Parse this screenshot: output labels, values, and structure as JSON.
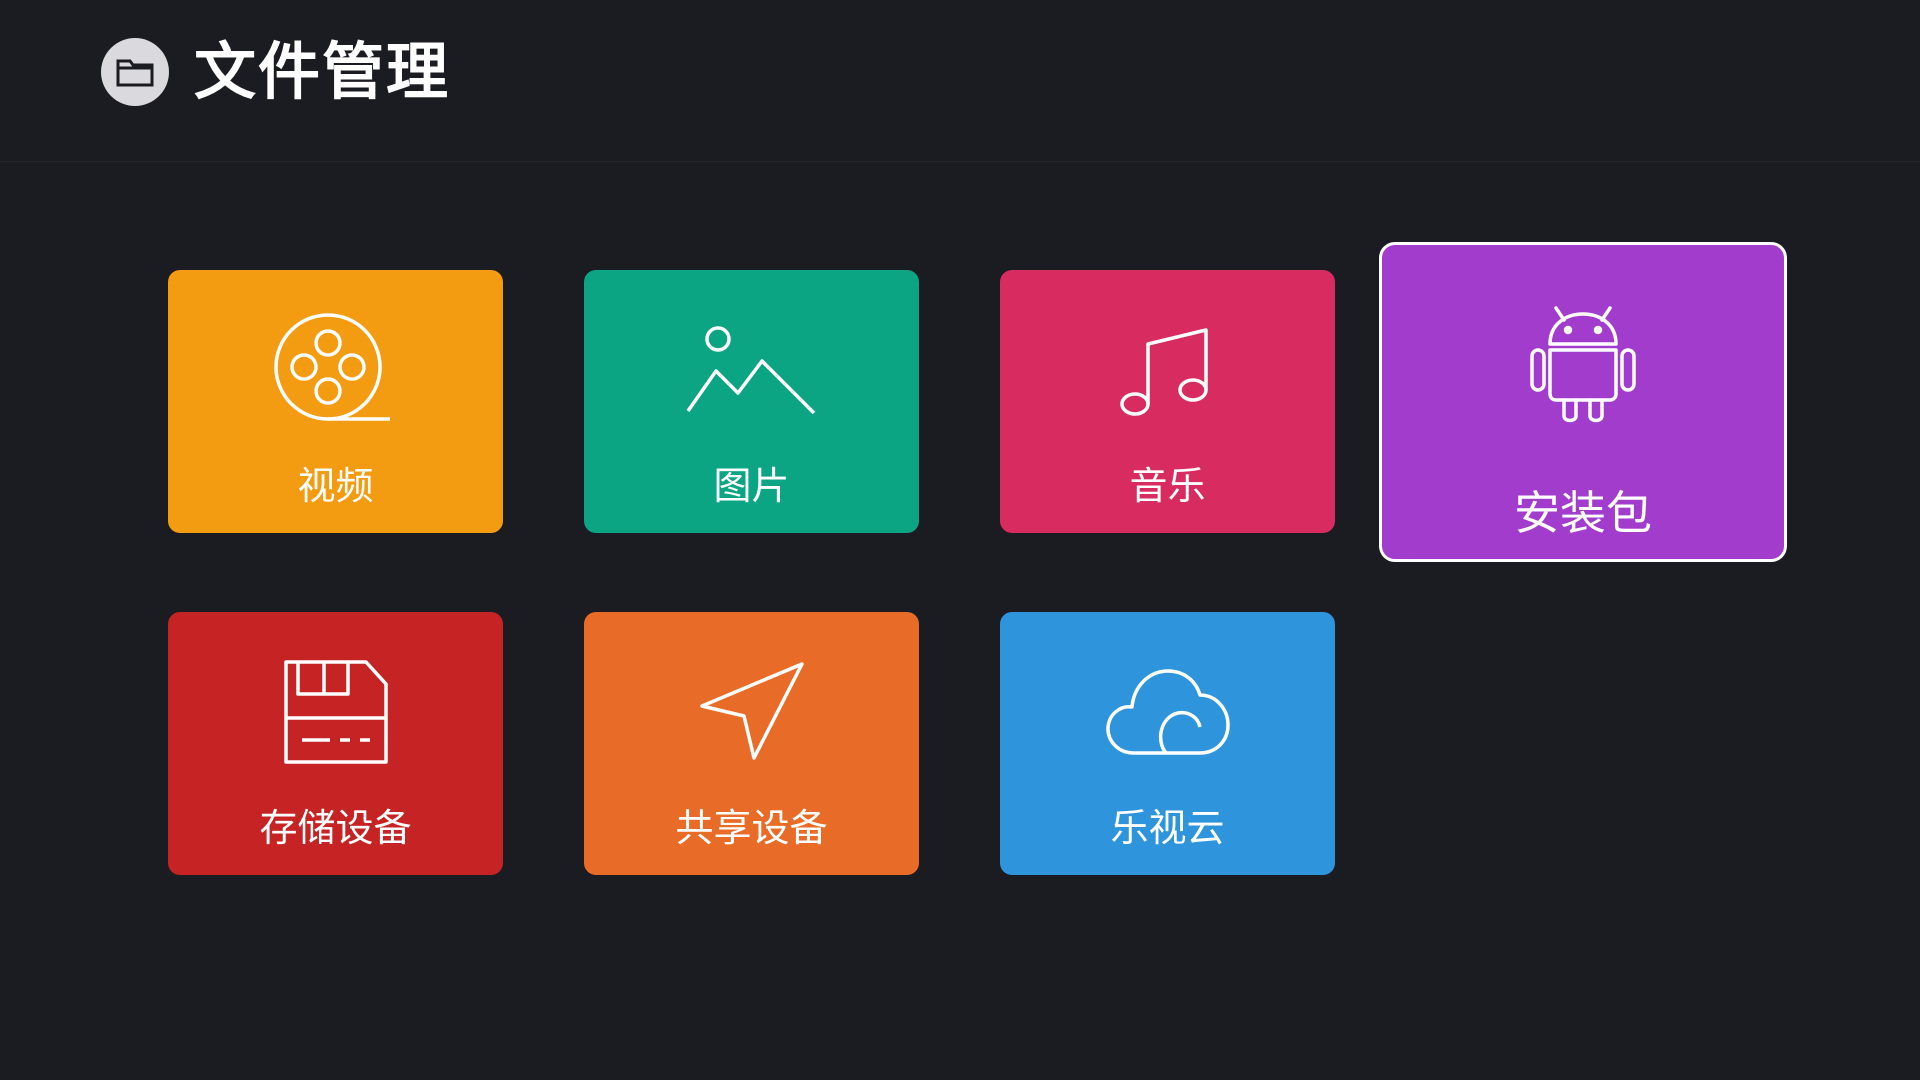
{
  "header": {
    "title": "文件管理",
    "icon": "folder-icon"
  },
  "tiles": [
    {
      "id": "video",
      "label": "视频",
      "icon": "film-reel-icon",
      "color": "#f39c12"
    },
    {
      "id": "pictures",
      "label": "图片",
      "icon": "mountain-image-icon",
      "color": "#0ca584"
    },
    {
      "id": "music",
      "label": "音乐",
      "icon": "music-note-icon",
      "color": "#d82b60"
    },
    {
      "id": "apk",
      "label": "安装包",
      "icon": "android-icon",
      "color": "#a23ccd",
      "focused": true
    },
    {
      "id": "storage",
      "label": "存储设备",
      "icon": "floppy-disk-icon",
      "color": "#c62424"
    },
    {
      "id": "shared",
      "label": "共享设备",
      "icon": "send-arrow-icon",
      "color": "#e96b28"
    },
    {
      "id": "cloud",
      "label": "乐视云",
      "icon": "cloud-icon",
      "color": "#2e95dd"
    }
  ]
}
